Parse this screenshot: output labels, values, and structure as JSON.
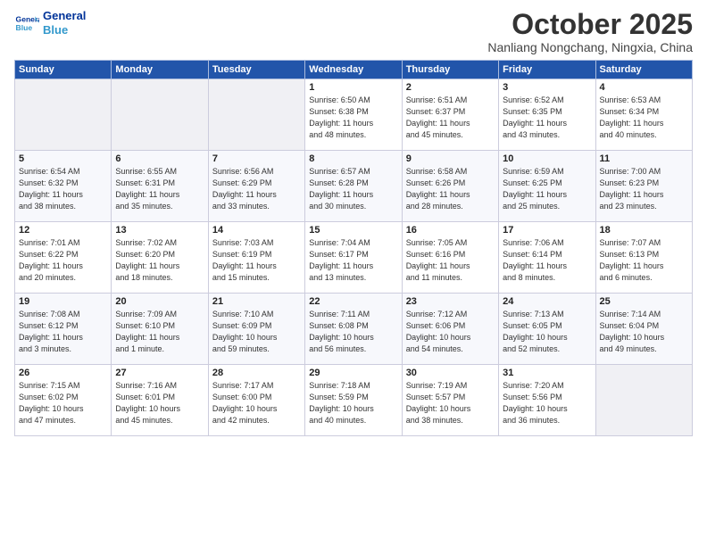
{
  "header": {
    "logo_line1": "General",
    "logo_line2": "Blue",
    "month": "October 2025",
    "location": "Nanliang Nongchang, Ningxia, China"
  },
  "days_of_week": [
    "Sunday",
    "Monday",
    "Tuesday",
    "Wednesday",
    "Thursday",
    "Friday",
    "Saturday"
  ],
  "weeks": [
    [
      {
        "day": "",
        "content": ""
      },
      {
        "day": "",
        "content": ""
      },
      {
        "day": "",
        "content": ""
      },
      {
        "day": "1",
        "content": "Sunrise: 6:50 AM\nSunset: 6:38 PM\nDaylight: 11 hours\nand 48 minutes."
      },
      {
        "day": "2",
        "content": "Sunrise: 6:51 AM\nSunset: 6:37 PM\nDaylight: 11 hours\nand 45 minutes."
      },
      {
        "day": "3",
        "content": "Sunrise: 6:52 AM\nSunset: 6:35 PM\nDaylight: 11 hours\nand 43 minutes."
      },
      {
        "day": "4",
        "content": "Sunrise: 6:53 AM\nSunset: 6:34 PM\nDaylight: 11 hours\nand 40 minutes."
      }
    ],
    [
      {
        "day": "5",
        "content": "Sunrise: 6:54 AM\nSunset: 6:32 PM\nDaylight: 11 hours\nand 38 minutes."
      },
      {
        "day": "6",
        "content": "Sunrise: 6:55 AM\nSunset: 6:31 PM\nDaylight: 11 hours\nand 35 minutes."
      },
      {
        "day": "7",
        "content": "Sunrise: 6:56 AM\nSunset: 6:29 PM\nDaylight: 11 hours\nand 33 minutes."
      },
      {
        "day": "8",
        "content": "Sunrise: 6:57 AM\nSunset: 6:28 PM\nDaylight: 11 hours\nand 30 minutes."
      },
      {
        "day": "9",
        "content": "Sunrise: 6:58 AM\nSunset: 6:26 PM\nDaylight: 11 hours\nand 28 minutes."
      },
      {
        "day": "10",
        "content": "Sunrise: 6:59 AM\nSunset: 6:25 PM\nDaylight: 11 hours\nand 25 minutes."
      },
      {
        "day": "11",
        "content": "Sunrise: 7:00 AM\nSunset: 6:23 PM\nDaylight: 11 hours\nand 23 minutes."
      }
    ],
    [
      {
        "day": "12",
        "content": "Sunrise: 7:01 AM\nSunset: 6:22 PM\nDaylight: 11 hours\nand 20 minutes."
      },
      {
        "day": "13",
        "content": "Sunrise: 7:02 AM\nSunset: 6:20 PM\nDaylight: 11 hours\nand 18 minutes."
      },
      {
        "day": "14",
        "content": "Sunrise: 7:03 AM\nSunset: 6:19 PM\nDaylight: 11 hours\nand 15 minutes."
      },
      {
        "day": "15",
        "content": "Sunrise: 7:04 AM\nSunset: 6:17 PM\nDaylight: 11 hours\nand 13 minutes."
      },
      {
        "day": "16",
        "content": "Sunrise: 7:05 AM\nSunset: 6:16 PM\nDaylight: 11 hours\nand 11 minutes."
      },
      {
        "day": "17",
        "content": "Sunrise: 7:06 AM\nSunset: 6:14 PM\nDaylight: 11 hours\nand 8 minutes."
      },
      {
        "day": "18",
        "content": "Sunrise: 7:07 AM\nSunset: 6:13 PM\nDaylight: 11 hours\nand 6 minutes."
      }
    ],
    [
      {
        "day": "19",
        "content": "Sunrise: 7:08 AM\nSunset: 6:12 PM\nDaylight: 11 hours\nand 3 minutes."
      },
      {
        "day": "20",
        "content": "Sunrise: 7:09 AM\nSunset: 6:10 PM\nDaylight: 11 hours\nand 1 minute."
      },
      {
        "day": "21",
        "content": "Sunrise: 7:10 AM\nSunset: 6:09 PM\nDaylight: 10 hours\nand 59 minutes."
      },
      {
        "day": "22",
        "content": "Sunrise: 7:11 AM\nSunset: 6:08 PM\nDaylight: 10 hours\nand 56 minutes."
      },
      {
        "day": "23",
        "content": "Sunrise: 7:12 AM\nSunset: 6:06 PM\nDaylight: 10 hours\nand 54 minutes."
      },
      {
        "day": "24",
        "content": "Sunrise: 7:13 AM\nSunset: 6:05 PM\nDaylight: 10 hours\nand 52 minutes."
      },
      {
        "day": "25",
        "content": "Sunrise: 7:14 AM\nSunset: 6:04 PM\nDaylight: 10 hours\nand 49 minutes."
      }
    ],
    [
      {
        "day": "26",
        "content": "Sunrise: 7:15 AM\nSunset: 6:02 PM\nDaylight: 10 hours\nand 47 minutes."
      },
      {
        "day": "27",
        "content": "Sunrise: 7:16 AM\nSunset: 6:01 PM\nDaylight: 10 hours\nand 45 minutes."
      },
      {
        "day": "28",
        "content": "Sunrise: 7:17 AM\nSunset: 6:00 PM\nDaylight: 10 hours\nand 42 minutes."
      },
      {
        "day": "29",
        "content": "Sunrise: 7:18 AM\nSunset: 5:59 PM\nDaylight: 10 hours\nand 40 minutes."
      },
      {
        "day": "30",
        "content": "Sunrise: 7:19 AM\nSunset: 5:57 PM\nDaylight: 10 hours\nand 38 minutes."
      },
      {
        "day": "31",
        "content": "Sunrise: 7:20 AM\nSunset: 5:56 PM\nDaylight: 10 hours\nand 36 minutes."
      },
      {
        "day": "",
        "content": ""
      }
    ]
  ]
}
